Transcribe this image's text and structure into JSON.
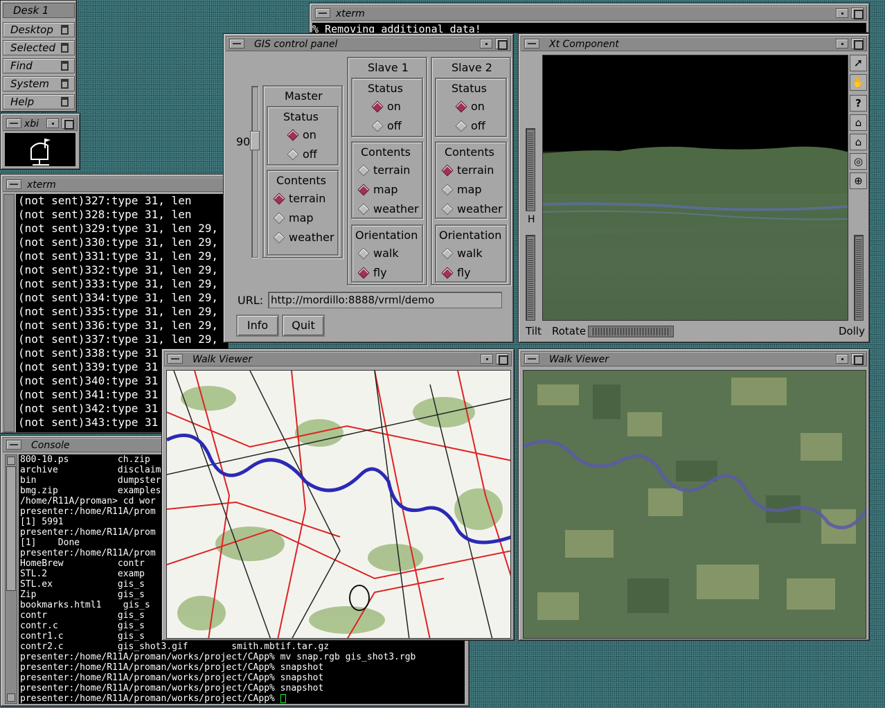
{
  "desk": {
    "title": "Desk 1",
    "items": [
      "Desktop",
      "Selected",
      "Find",
      "System",
      "Help"
    ]
  },
  "xbi": {
    "title": "xbi",
    "logo_text": "xbi"
  },
  "xterm_top": {
    "title": "xterm",
    "line": "% Removing additional data!"
  },
  "xterm_left": {
    "title": "xterm",
    "lines": [
      "(not sent)327:type 31, len",
      "(not sent)328:type 31, len",
      "(not sent)329:type 31, len 29,",
      "(not sent)330:type 31, len 29,",
      "(not sent)331:type 31, len 29,",
      "(not sent)332:type 31, len 29,",
      "(not sent)333:type 31, len 29,",
      "(not sent)334:type 31, len 29,",
      "(not sent)335:type 31, len 29,",
      "(not sent)336:type 31, len 29,",
      "(not sent)337:type 31, len 29,",
      "(not sent)338:type 31",
      "(not sent)339:type 31",
      "(not sent)340:type 31",
      "(not sent)341:type 31",
      "(not sent)342:type 31",
      "(not sent)343:type 31"
    ]
  },
  "console": {
    "title": "Console",
    "lines": [
      "800-10.ps         ch.zip",
      "archive           disclaime",
      "bin               dumpster",
      "bmg.zip           examples.",
      "/home/R11A/proman> cd wor",
      "presenter:/home/R11A/prom",
      "[1] 5991",
      "presenter:/home/R11A/prom",
      "[1]    Done",
      "presenter:/home/R11A/prom",
      "HomeBrew          contr",
      "STL.2             examp",
      "STL.ex            gis_s",
      "Zip               gis_s",
      "bookmarks.html1    gis_s",
      "contr             gis_s",
      "contr.c           gis_s",
      "contr1.c          gis_s",
      "contr2.c          gis_shot3.gif        smith.mbtif.tar.gz",
      "presenter:/home/R11A/proman/works/project/CApp% mv snap.rgb gis_shot3.rgb",
      "presenter:/home/R11A/proman/works/project/CApp% snapshot",
      "presenter:/home/R11A/proman/works/project/CApp% snapshot",
      "presenter:/home/R11A/proman/works/project/CApp% snapshot",
      "presenter:/home/R11A/proman/works/project/CApp% "
    ]
  },
  "gis": {
    "title": "GIS control panel",
    "slider_value": "90",
    "master": {
      "title": "Master",
      "status_title": "Status",
      "on": "on",
      "off": "off",
      "contents_title": "Contents",
      "terrain": "terrain",
      "map": "map",
      "weather": "weather"
    },
    "slave1": {
      "title": "Slave 1",
      "status_title": "Status",
      "on": "on",
      "off": "off",
      "contents_title": "Contents",
      "terrain": "terrain",
      "map": "map",
      "weather": "weather",
      "orientation_title": "Orientation",
      "walk": "walk",
      "fly": "fly"
    },
    "slave2": {
      "title": "Slave 2",
      "status_title": "Status",
      "on": "on",
      "off": "off",
      "contents_title": "Contents",
      "terrain": "terrain",
      "map": "map",
      "weather": "weather",
      "orientation_title": "Orientation",
      "walk": "walk",
      "fly": "fly"
    },
    "url_label": "URL:",
    "url_value": "http://mordillo:8888/vrml/demo",
    "info_label": "Info",
    "quit_label": "Quit"
  },
  "xt": {
    "title": "Xt Component",
    "h_label": "H",
    "tilt_label": "Tilt",
    "rotate_label": "Rotate",
    "dolly_label": "Dolly"
  },
  "walk1": {
    "title": "Walk Viewer"
  },
  "walk2": {
    "title": "Walk Viewer"
  },
  "selections": {
    "master": {
      "status": "on",
      "contents": "terrain"
    },
    "slave1": {
      "status": "on",
      "contents": "map",
      "orientation": "fly"
    },
    "slave2": {
      "status": "on",
      "contents": "terrain",
      "orientation": "fly"
    }
  }
}
